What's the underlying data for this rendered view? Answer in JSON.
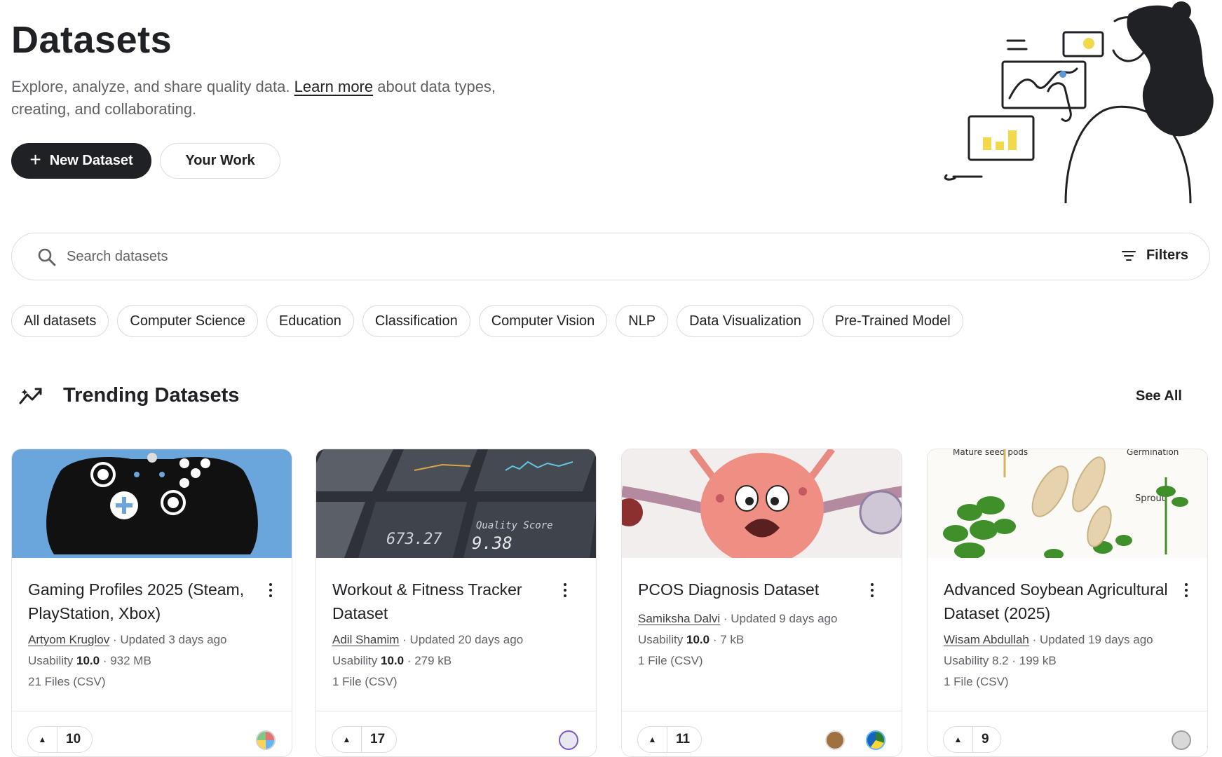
{
  "header": {
    "title": "Datasets",
    "subtitle_before": "Explore, analyze, and share quality data.",
    "subtitle_link": "Learn more",
    "subtitle_after": "about data types, creating, and collaborating.",
    "new_dataset_label": "New Dataset",
    "your_work_label": "Your Work"
  },
  "search": {
    "placeholder": "Search datasets",
    "filters_label": "Filters"
  },
  "chips": [
    "All datasets",
    "Computer Science",
    "Education",
    "Classification",
    "Computer Vision",
    "NLP",
    "Data Visualization",
    "Pre-Trained Model"
  ],
  "trending": {
    "title": "Trending Datasets",
    "see_all": "See All"
  },
  "cards": [
    {
      "title": "Gaming Profiles 2025 (Steam, PlayStation, Xbox)",
      "author": "Artyom Kruglov",
      "updated": "· Updated 3 days ago",
      "usability_label": "Usability",
      "usability": "10.0",
      "size": "· 932 MB",
      "files": "21 Files (CSV)",
      "votes": "10",
      "thumb_color": "#6aa6dc"
    },
    {
      "title": "Workout & Fitness Tracker Dataset",
      "author": "Adil Shamim",
      "updated": "· Updated 20 days ago",
      "usability_label": "Usability",
      "usability": "10.0",
      "size": "· 279 kB",
      "files": "1 File (CSV)",
      "votes": "17",
      "thumb_color": "#3a3d44",
      "thumb_text_1": "673.27",
      "thumb_text_2": "Quality Score",
      "thumb_text_3": "9.38"
    },
    {
      "title": "PCOS Diagnosis Dataset",
      "author": "Samiksha Dalvi",
      "updated": "· Updated 9 days ago",
      "usability_label": "Usability",
      "usability": "10.0",
      "size": "· 7 kB",
      "files": "1 File (CSV)",
      "votes": "11",
      "thumb_color": "#f3eeee"
    },
    {
      "title": "Advanced Soybean Agricultural Dataset (2025)",
      "author": "Wisam Abdullah",
      "updated": "· Updated 19 days ago",
      "usability_label": "Usability",
      "usability": "8.2",
      "size": "· 199 kB",
      "files": "1 File (CSV)",
      "votes": "9",
      "thumb_color": "#fbfaf6",
      "thumb_text_1": "Mature seed pods",
      "thumb_text_2": "Germination",
      "thumb_text_3": "Sprout"
    }
  ]
}
